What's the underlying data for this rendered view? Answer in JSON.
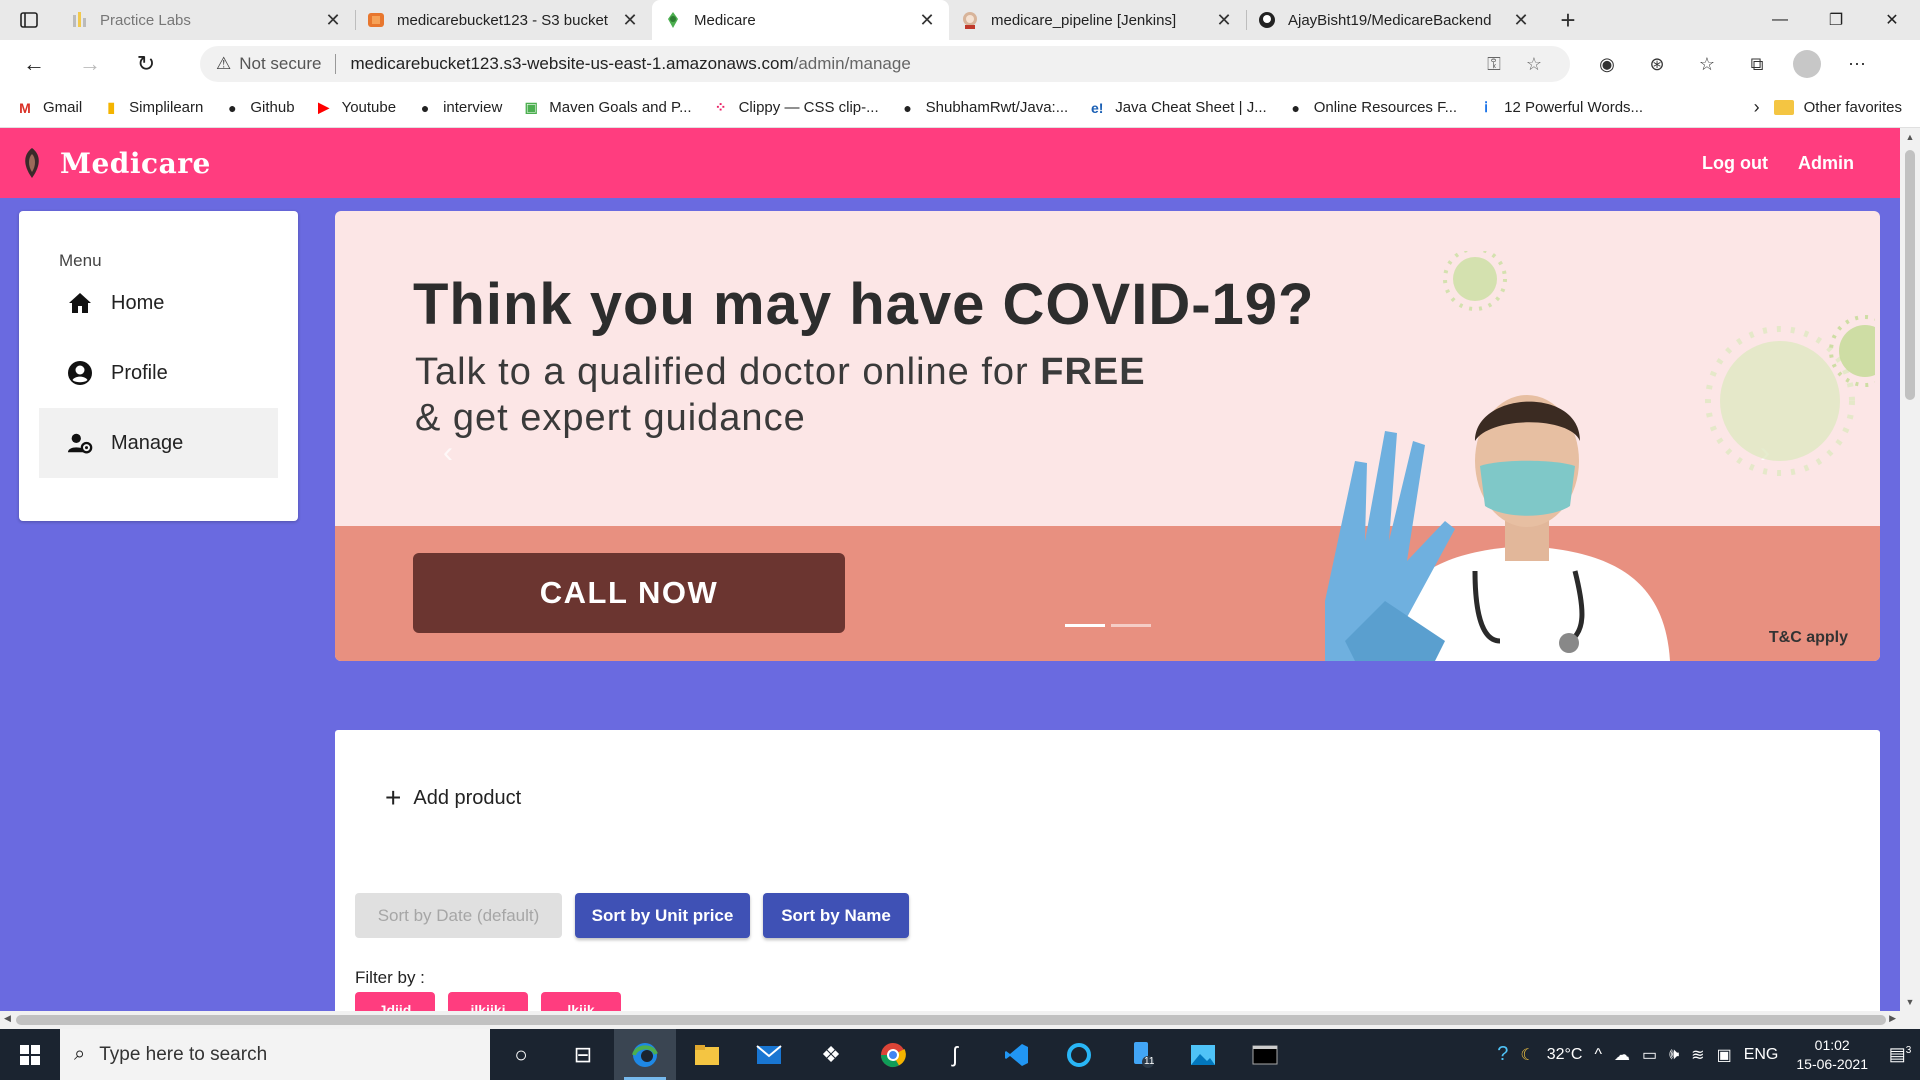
{
  "browser": {
    "tabs": [
      {
        "title": "Practice Labs",
        "favicon": "practicelabs-icon",
        "active": false,
        "dim": true
      },
      {
        "title": "medicarebucket123 - S3 bucket",
        "favicon": "aws-s3-icon",
        "active": false
      },
      {
        "title": "Medicare",
        "favicon": "medicare-icon",
        "active": true
      },
      {
        "title": "medicare_pipeline [Jenkins]",
        "favicon": "jenkins-icon",
        "active": false
      },
      {
        "title": "AjayBisht19/MedicareBackend",
        "favicon": "github-icon",
        "active": false
      }
    ],
    "address": {
      "security_label": "Not secure",
      "host": "medicarebucket123.s3-website-us-east-1.amazonaws.com",
      "path": "/admin/manage"
    },
    "bookmarks": [
      {
        "label": "Gmail",
        "icon": "gmail-icon",
        "color": "#d93025"
      },
      {
        "label": "Simplilearn",
        "icon": "simplilearn-icon",
        "color": "#f4b400"
      },
      {
        "label": "Github",
        "icon": "github-icon",
        "color": "#222222"
      },
      {
        "label": "Youtube",
        "icon": "youtube-icon",
        "color": "#ff0000"
      },
      {
        "label": "interview",
        "icon": "github-icon",
        "color": "#222222"
      },
      {
        "label": "Maven Goals and P...",
        "icon": "page-icon",
        "color": "#4caf50"
      },
      {
        "label": "Clippy — CSS clip-...",
        "icon": "clippy-icon",
        "color": "#e91e63"
      },
      {
        "label": "ShubhamRwt/Java:...",
        "icon": "github-icon",
        "color": "#222222"
      },
      {
        "label": "Java Cheat Sheet | J...",
        "icon": "edureka-icon",
        "color": "#1a5fb4"
      },
      {
        "label": "Online Resources F...",
        "icon": "github-icon",
        "color": "#222222"
      },
      {
        "label": "12 Powerful Words...",
        "icon": "info-icon",
        "color": "#1a73e8"
      }
    ],
    "other_favorites": "Other favorites"
  },
  "app": {
    "brand": "Medicare",
    "nav": {
      "logout": "Log out",
      "admin": "Admin"
    },
    "colors": {
      "header": "#ff3d7f",
      "background": "#6a6ae0",
      "primary_button": "#3f51b5"
    },
    "menu": {
      "heading": "Menu",
      "items": [
        {
          "label": "Home",
          "icon": "home-icon",
          "selected": false
        },
        {
          "label": "Profile",
          "icon": "account-circle-icon",
          "selected": false
        },
        {
          "label": "Manage",
          "icon": "manage-accounts-icon",
          "selected": true
        }
      ]
    },
    "banner": {
      "headline": "Think you may have COVID-19?",
      "sub_line1_prefix": "Talk to a qualified doctor online for ",
      "sub_line1_bold": "FREE",
      "sub_line2": "& get expert guidance",
      "cta": "CALL NOW",
      "terms": "T&C apply",
      "slides": 2,
      "active_slide": 1
    },
    "products": {
      "add_label": "Add product",
      "sort_buttons": [
        {
          "label": "Sort by Date (default)",
          "disabled": true
        },
        {
          "label": "Sort by Unit price",
          "disabled": false
        },
        {
          "label": "Sort by Name",
          "disabled": false
        }
      ],
      "filter_label": "Filter by :",
      "filter_chips": [
        "Jdjjd",
        "jlkjjkj",
        "lkjjk"
      ]
    }
  },
  "taskbar": {
    "search_placeholder": "Type here to search",
    "apps": [
      "task-view-icon",
      "cortana-icon",
      "edge-icon",
      "file-explorer-icon",
      "mail-icon",
      "dropbox-icon",
      "chrome-icon",
      "sublime-icon",
      "vscode-icon",
      "alexa-icon",
      "phone-icon",
      "photos-icon",
      "terminal-icon"
    ],
    "phone_badge": "11",
    "weather": "32°C",
    "language": "ENG",
    "time": "01:02",
    "date": "15-06-2021",
    "notifications": "3"
  }
}
